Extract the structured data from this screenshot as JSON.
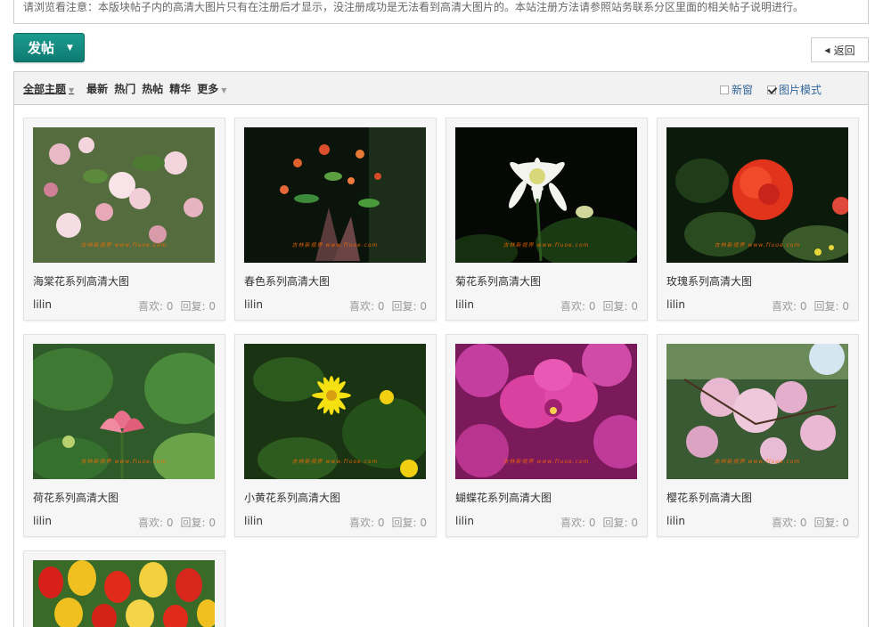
{
  "notice": "请浏览看注意：本版块帖子内的高清大图片只有在注册后才显示，没注册成功是无法看到高清大图片的。本站注册方法请参照站务联系分区里面的相关帖子说明进行。",
  "post_button": "发帖",
  "back_button": "返回",
  "filters": {
    "all": "全部主题",
    "latest": "最新",
    "hot": "热门",
    "hot_posts": "热帖",
    "digest": "精华",
    "more": "更多"
  },
  "options": {
    "new_window": "新窗",
    "new_window_checked": false,
    "picture_mode": "图片模式",
    "picture_mode_checked": true
  },
  "watermark": "古林新视界 www.fluoe.com",
  "cards": [
    {
      "title": "海棠花系列高清大图",
      "author": "lilin",
      "likes": "喜欢: 0",
      "replies": "回复: 0"
    },
    {
      "title": "春色系列高清大图",
      "author": "lilin",
      "likes": "喜欢: 0",
      "replies": "回复: 0"
    },
    {
      "title": "菊花系列高清大图",
      "author": "lilin",
      "likes": "喜欢: 0",
      "replies": "回复: 0"
    },
    {
      "title": "玫瑰系列高清大图",
      "author": "lilin",
      "likes": "喜欢: 0",
      "replies": "回复: 0"
    },
    {
      "title": "荷花系列高清大图",
      "author": "lilin",
      "likes": "喜欢: 0",
      "replies": "回复: 0"
    },
    {
      "title": "小黄花系列高清大图",
      "author": "lilin",
      "likes": "喜欢: 0",
      "replies": "回复: 0"
    },
    {
      "title": "蝴蝶花系列高清大图",
      "author": "lilin",
      "likes": "喜欢: 0",
      "replies": "回复: 0"
    },
    {
      "title": "樱花系列高清大图",
      "author": "lilin",
      "likes": "喜欢: 0",
      "replies": "回复: 0"
    }
  ]
}
